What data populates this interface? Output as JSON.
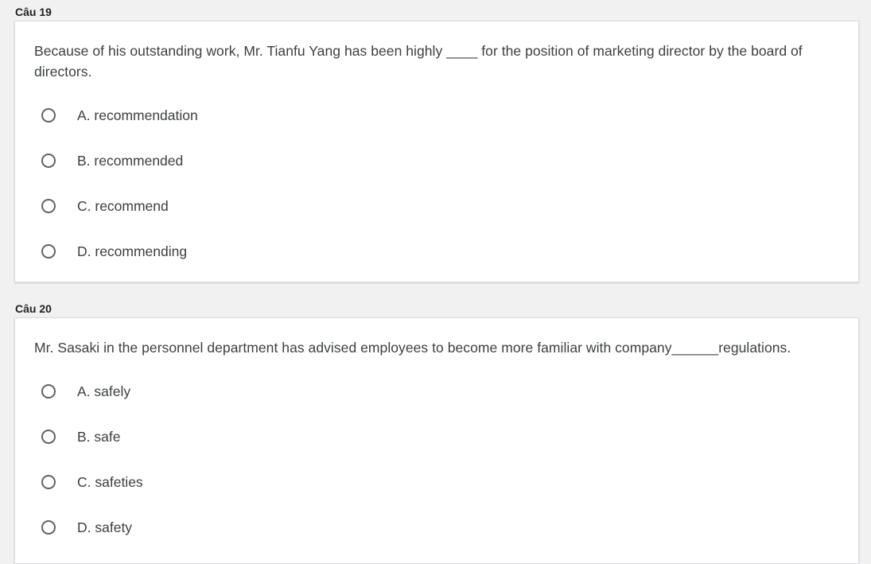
{
  "questions": [
    {
      "header": "Câu 19",
      "text": "Because of his outstanding work, Mr. Tianfu Yang has been highly ____ for the position of marketing director by the board of directors.",
      "options": [
        "A. recommendation",
        "B. recommended",
        "C. recommend",
        "D. recommending"
      ]
    },
    {
      "header": "Câu 20",
      "text": "Mr. Sasaki in the personnel department has advised employees to become more familiar with company______regulations.",
      "options": [
        "A. safely",
        "B. safe",
        "C. safeties",
        "D. safety"
      ]
    }
  ]
}
